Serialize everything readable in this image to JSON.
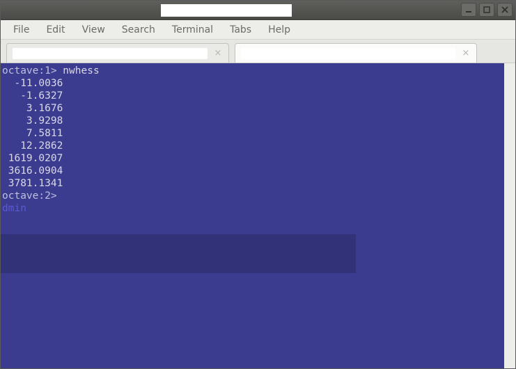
{
  "titlebar": {
    "title": ""
  },
  "menubar": {
    "items": [
      "File",
      "Edit",
      "View",
      "Search",
      "Terminal",
      "Tabs",
      "Help"
    ]
  },
  "tabs": {
    "inactive_label": "",
    "active_label": ""
  },
  "terminal": {
    "prompt1": "octave:1>",
    "command1": " nwhess",
    "output": [
      "  -11.0036",
      "   -1.6327",
      "    3.1676",
      "    3.9298",
      "    7.5811",
      "   12.2862",
      " 1619.0207",
      " 3616.0904",
      " 3781.1341"
    ],
    "prompt2": "octave:2>",
    "link": "dmin"
  }
}
